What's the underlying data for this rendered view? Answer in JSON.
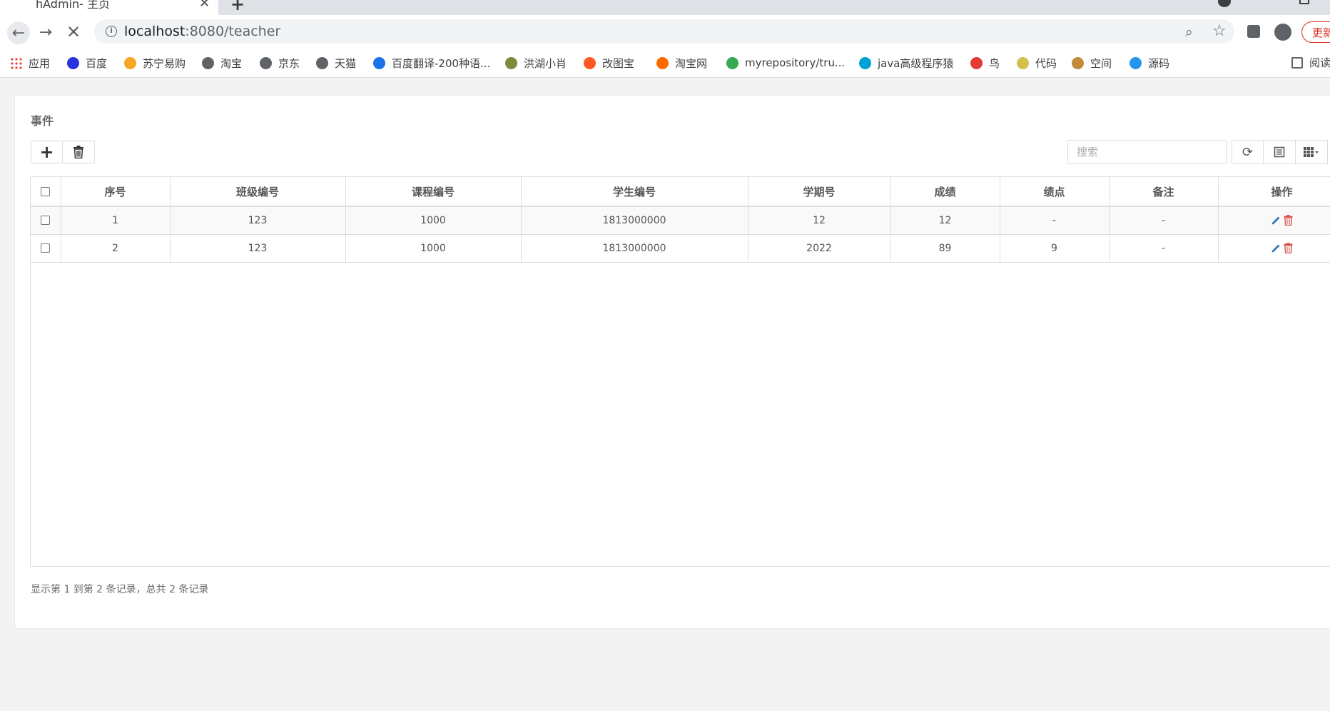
{
  "browser": {
    "tab_title": "hAdmin- 主页",
    "url_host": "localhost",
    "url_path": ":8080/teacher",
    "update_label": "更新",
    "reader_label": "阅读清单",
    "bookmarks": [
      {
        "label": "应用",
        "icon": "apps-grid-icon",
        "color": "#ea4335"
      },
      {
        "label": "百度",
        "icon": "baidu-paw-icon",
        "color": "#2932e1"
      },
      {
        "label": "苏宁易购",
        "icon": "suning-lion-icon",
        "color": "#f5a623"
      },
      {
        "label": "淘宝",
        "icon": "globe-icon",
        "color": "#5f6368"
      },
      {
        "label": "京东",
        "icon": "globe-icon",
        "color": "#5f6368"
      },
      {
        "label": "天猫",
        "icon": "globe-icon",
        "color": "#5f6368"
      },
      {
        "label": "百度翻译-200种语...",
        "icon": "translate-icon",
        "color": "#1a73e8"
      },
      {
        "label": "洪湖小肖",
        "icon": "bird-icon",
        "color": "#7b8c3a"
      },
      {
        "label": "改图宝",
        "icon": "gaitubao-icon",
        "color": "#ff5722"
      },
      {
        "label": "淘宝网",
        "icon": "taobao-icon",
        "color": "#ff6a00"
      },
      {
        "label": "myrepository/tru...",
        "icon": "chrome-icon",
        "color": "#34a853"
      },
      {
        "label": "java高级程序猿",
        "icon": "bilibili-icon",
        "color": "#00a1d6"
      },
      {
        "label": "鸟",
        "icon": "red-bird-icon",
        "color": "#e53935"
      },
      {
        "label": "代码",
        "icon": "code-icon",
        "color": "#d4c04a"
      },
      {
        "label": "空间",
        "icon": "qzone-icon",
        "color": "#c28a3a"
      },
      {
        "label": "源码",
        "icon": "docker-icon",
        "color": "#2496ed"
      }
    ]
  },
  "page": {
    "title": "事件",
    "search_placeholder": "搜索",
    "footer": "显示第 1 到第 2 条记录，总共 2 条记录"
  },
  "table": {
    "columns": [
      "序号",
      "班级编号",
      "课程编号",
      "学生编号",
      "学期号",
      "成绩",
      "绩点",
      "备注",
      "操作"
    ],
    "rows": [
      [
        "1",
        "123",
        "1000",
        "1813000000",
        "12",
        "12",
        "-",
        "-"
      ],
      [
        "2",
        "123",
        "1000",
        "1813000000",
        "2022",
        "89",
        "9",
        "-"
      ]
    ]
  },
  "colors": {
    "edit": "#337ab7",
    "delete": "#d9534f",
    "update_accent": "#d93025"
  }
}
